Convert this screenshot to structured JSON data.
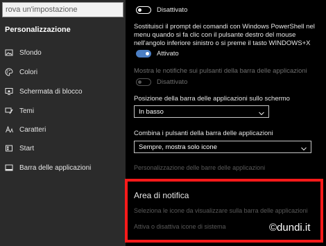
{
  "sidebar": {
    "search_placeholder": "rova un'impostazione",
    "title": "Personalizzazione",
    "items": [
      {
        "label": "Sfondo",
        "icon": "image-icon"
      },
      {
        "label": "Colori",
        "icon": "palette-icon"
      },
      {
        "label": "Schermata di blocco",
        "icon": "lock-screen-icon"
      },
      {
        "label": "Temi",
        "icon": "brush-icon"
      },
      {
        "label": "Caratteri",
        "icon": "font-icon"
      },
      {
        "label": "Start",
        "icon": "start-icon"
      },
      {
        "label": "Barra delle applicazioni",
        "icon": "taskbar-icon"
      }
    ]
  },
  "main": {
    "toggle1": {
      "state": "Disattivato"
    },
    "powershell": {
      "line1": "Sostituisci il prompt dei comandi con Windows PowerShell nel",
      "line2": "menu quando si fa clic con il pulsante destro del mouse",
      "line3": "nell'angolo inferiore sinistro o si preme il tasto WINDOWS+X",
      "state": "Attivato"
    },
    "badges": {
      "label": "Mostra le notifiche sui pulsanti della barra delle applicazioni",
      "state": "Disattivato"
    },
    "position": {
      "label": "Posizione della barra delle applicazioni sullo schermo",
      "value": "In basso"
    },
    "combine": {
      "label": "Combina i pulsanti della barra delle applicazioni",
      "value": "Sempre, mostra solo icone"
    },
    "customize_link": "Personalizzazione delle barre delle applicazioni",
    "notification_area": {
      "title": "Area di notifica",
      "link1": "Seleziona le icone da visualizzare sulla barra delle applicazioni",
      "link2": "Attiva o disattiva icone di sistema"
    }
  },
  "watermark": "©dundi.it",
  "colors": {
    "sidebar_bg": "#2b2b2b",
    "main_bg": "#000000",
    "accent": "#4b7fc5",
    "highlight": "#ff1a1a"
  }
}
